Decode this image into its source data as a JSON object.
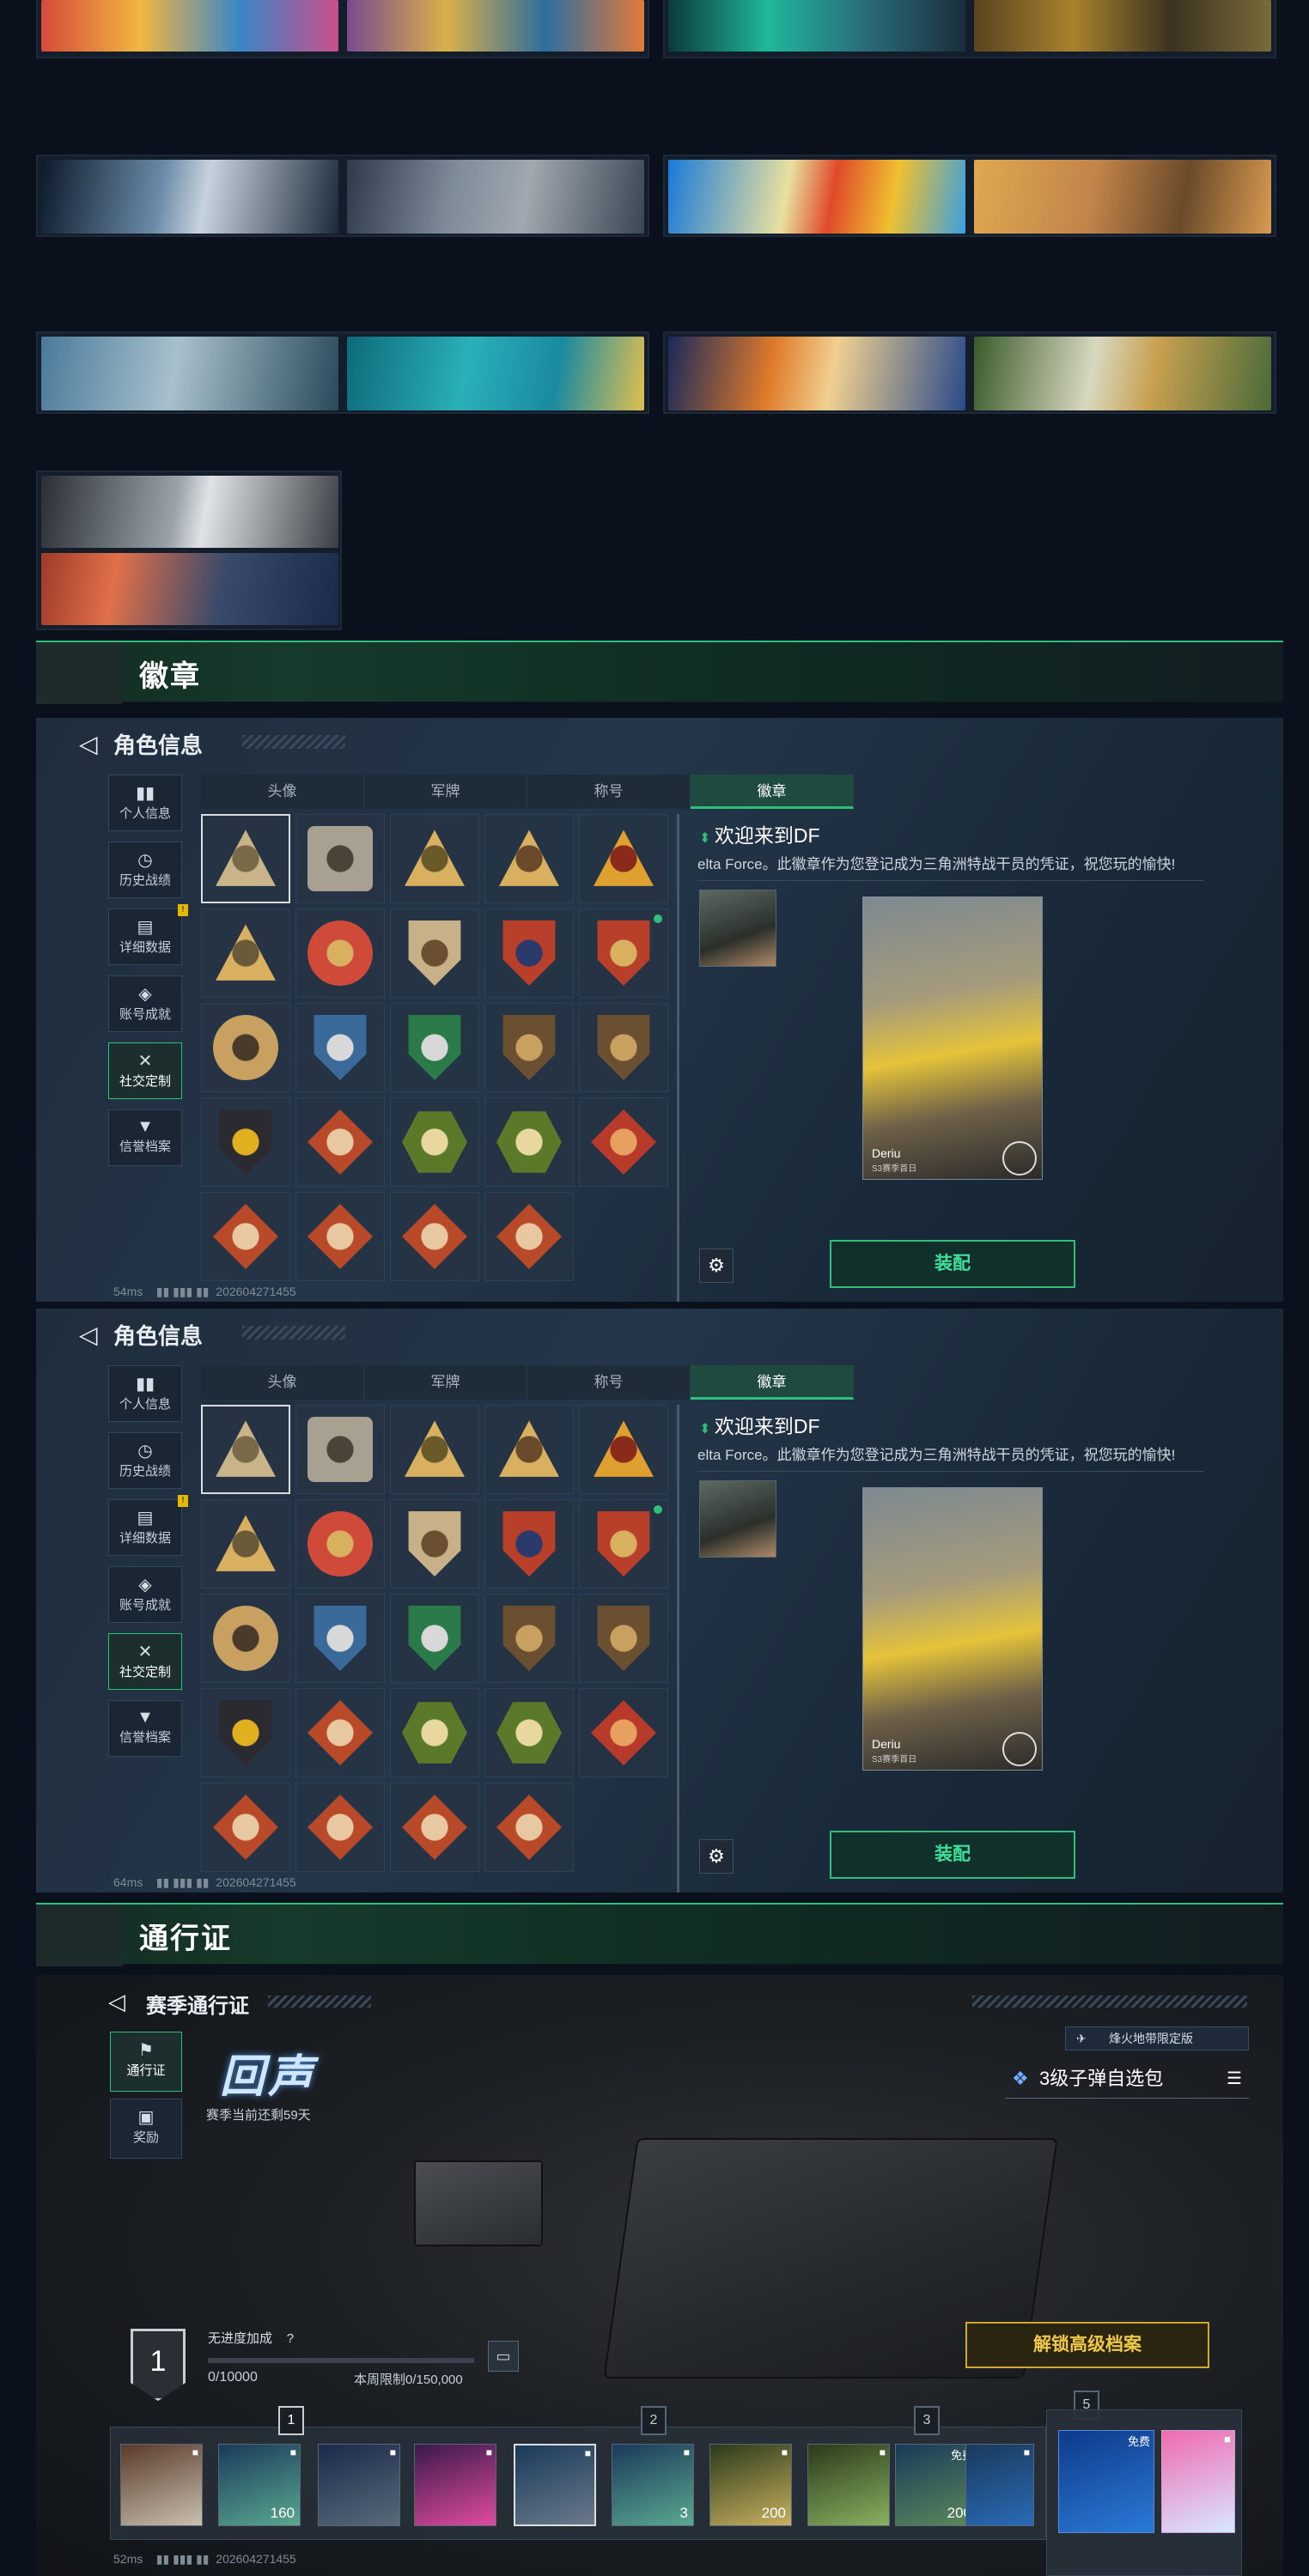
{
  "colors": {
    "accent": "#2fbf7c",
    "gold": "#e6b800",
    "bg": "#0b111c"
  },
  "sections": {
    "badges_title": "徽章",
    "pass_title": "通行证"
  },
  "badge_panel": {
    "title": "角色信息",
    "side_items": [
      {
        "label": "个人信息",
        "icon": "bar-chart-icon"
      },
      {
        "label": "历史战绩",
        "icon": "history-icon"
      },
      {
        "label": "详细数据",
        "icon": "folder-icon"
      },
      {
        "label": "账号成就",
        "icon": "achievement-icon"
      },
      {
        "label": "社交定制",
        "icon": "tools-icon"
      },
      {
        "label": "信誉档案",
        "icon": "shield-icon"
      }
    ],
    "tabs": [
      "头像",
      "军牌",
      "称号",
      "徽章"
    ],
    "welcome_title": "欢迎来到DF",
    "welcome_desc": "elta Force。此徽章作为您登记成为三角洲特战干员的凭证，祝您玩的愉快!",
    "card_name": "Deriu",
    "card_sub": "S3赛季首日",
    "equip_label": "装配",
    "status_top": "54ms",
    "status_id_top": "202604271455",
    "status_bottom": "64ms",
    "status_id_bottom": "202604271455",
    "new_badge_mark": "!"
  },
  "pass_panel": {
    "title": "赛季通行证",
    "side_items": [
      {
        "label": "通行证",
        "icon": "pass-icon"
      },
      {
        "label": "奖励",
        "icon": "gift-icon"
      }
    ],
    "logo_text": "回声",
    "days_left": "赛季当前还剩59天",
    "tag_label": "烽火地带限定版",
    "bundle_label": "3级子弹自选包",
    "level": "1",
    "bonus_label": "无进度加成",
    "progress": "0/10000",
    "weekly_limit": "本周限制0/150,000",
    "unlock_button": "解锁高级档案",
    "tier_markers": [
      "1",
      "2",
      "3",
      "5"
    ],
    "free_label": "免费",
    "item_counts": [
      "160",
      "3",
      "200",
      "200"
    ],
    "status_ping": "52ms",
    "status_id": "202604271455"
  }
}
